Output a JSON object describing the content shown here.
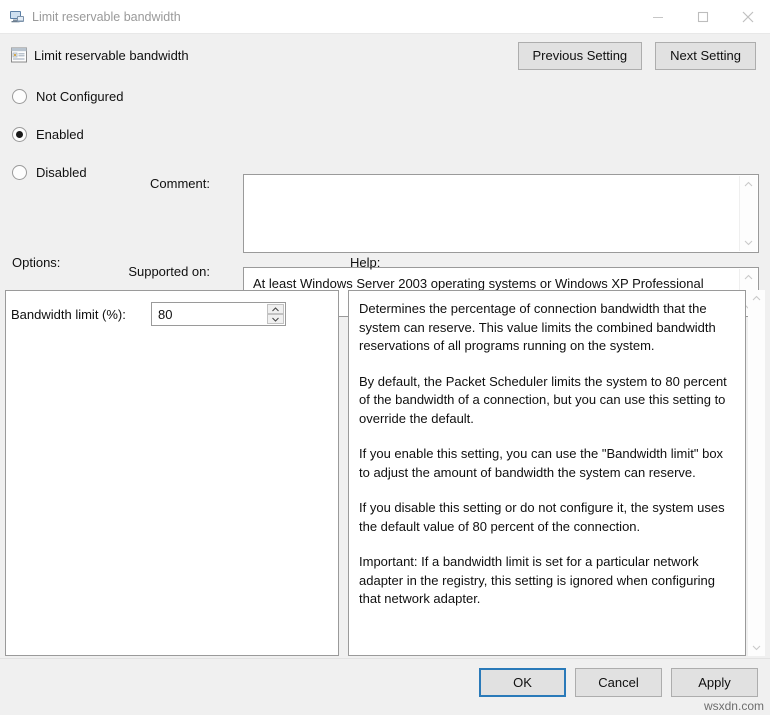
{
  "window": {
    "title": "Limit reservable bandwidth",
    "icon": "computer-icon",
    "minimize_label": "–",
    "maximize_label": "□",
    "close_label": "✕"
  },
  "header": {
    "icon": "policy-setting-icon",
    "title": "Limit reservable bandwidth",
    "previous_setting_label": "Previous Setting",
    "next_setting_label": "Next Setting"
  },
  "state": {
    "options": [
      {
        "label": "Not Configured",
        "selected": false
      },
      {
        "label": "Enabled",
        "selected": true
      },
      {
        "label": "Disabled",
        "selected": false
      }
    ]
  },
  "comment": {
    "label": "Comment:",
    "value": ""
  },
  "supported_on": {
    "label": "Supported on:",
    "value": "At least Windows Server 2003 operating systems or Windows XP Professional"
  },
  "options_panel": {
    "label": "Options:",
    "bandwidth_limit_label": "Bandwidth limit (%):",
    "bandwidth_limit_value": "80"
  },
  "help_panel": {
    "label": "Help:",
    "paragraphs": [
      "Determines the percentage of connection bandwidth that the system can reserve. This value limits the combined bandwidth reservations of all programs running on the system.",
      "By default, the Packet Scheduler limits the system to 80 percent of the bandwidth of a connection, but you can use this setting to override the default.",
      "If you enable this setting, you can use the \"Bandwidth limit\" box to adjust the amount of bandwidth the system can reserve.",
      "If you disable this setting or do not configure it, the system uses the default value of 80 percent of the connection.",
      "Important: If a bandwidth limit is set for a particular network adapter in the registry, this setting is ignored when configuring that network adapter."
    ]
  },
  "footer": {
    "ok_label": "OK",
    "cancel_label": "Cancel",
    "apply_label": "Apply"
  },
  "watermark": {
    "text": "wsxdn.com"
  },
  "colors": {
    "dialog_bg": "#f0f0f0",
    "button_face": "#e1e1e1",
    "button_border": "#adadad",
    "focus_blue": "#2a7ab9",
    "field_border": "#9a9a9a",
    "title_text": "#9a9a9a"
  }
}
